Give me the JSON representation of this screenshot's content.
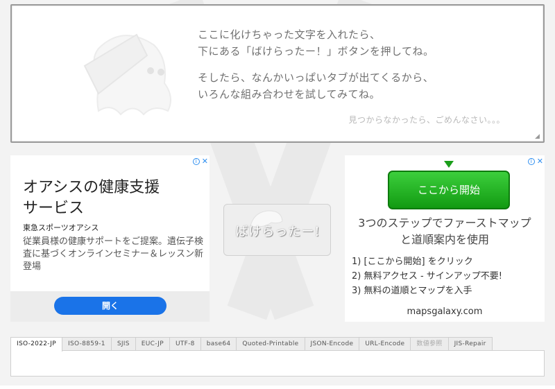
{
  "input": {
    "hint_lines_1": [
      "ここに化けちゃった文字を入れたら、",
      "下にある「ばけらったー！」ボタンを押してね。"
    ],
    "hint_lines_2": [
      "そしたら、なんかいっぱいタブが出てくるから、",
      "いろんな組み合わせを試してみてね。"
    ],
    "sorry": "見つからなかったら、ごめんなさい。。。"
  },
  "ad_left": {
    "headline_1": "オアシスの健康支援",
    "headline_2": "サービス",
    "advertiser": "東急スポーツオアシス",
    "body": "従業員様の健康サポートをご提案。遺伝子検査に基づくオンラインセミナー＆レッスン新登場",
    "cta": "開く",
    "adchoice_icon": "info-icon",
    "close_icon": "close-icon"
  },
  "ad_right": {
    "button": "ここから開始",
    "title_1": "3つのステップでファーストマップ",
    "title_2": "と道順案内を使用",
    "steps": [
      "1) [ここから開始] をクリック",
      "2) 無料アクセス - サインアップ不要!",
      "3) 無料の道順とマップを入手"
    ],
    "domain": "mapsgalaxy.com"
  },
  "bake_button": {
    "label": "ばけらったー!"
  },
  "tabs": [
    {
      "label": "ISO-2022-JP",
      "active": true
    },
    {
      "label": "ISO-8859-1"
    },
    {
      "label": "SJIS"
    },
    {
      "label": "EUC-JP"
    },
    {
      "label": "UTF-8"
    },
    {
      "label": "base64"
    },
    {
      "label": "Quoted-Printable"
    },
    {
      "label": "JSON-Encode"
    },
    {
      "label": "URL-Encode"
    },
    {
      "label": "数値参照",
      "dim": true
    },
    {
      "label": "JIS-Repair"
    }
  ],
  "colors": {
    "ad_button_blue": "#1a73e8",
    "start_button_green": "#129a12",
    "adchoice_blue": "#2f8ff0"
  }
}
